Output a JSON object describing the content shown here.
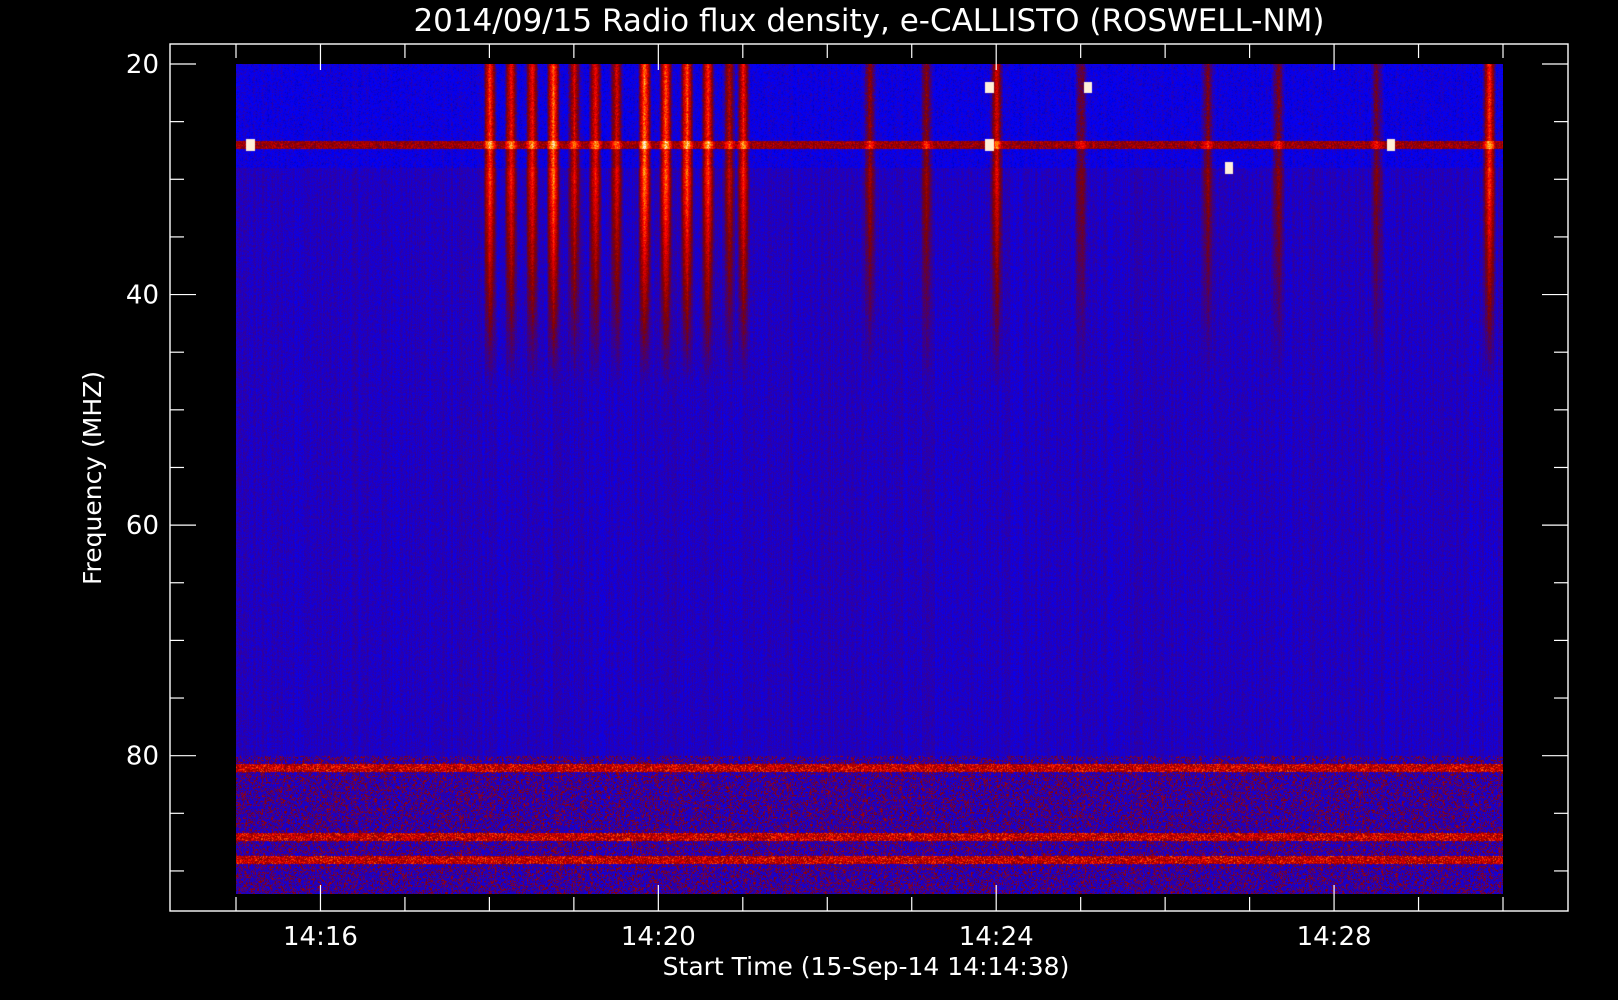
{
  "chart_data": {
    "type": "heatmap",
    "title": "2014/09/15  Radio flux density, e-CALLISTO (ROSWELL-NM)",
    "xlabel": "Start Time (15-Sep-14 14:14:38)",
    "ylabel": "Frequency (MHZ)",
    "x_axis": {
      "unit": "clock time",
      "range": [
        "14:14:38",
        "14:29:58"
      ],
      "major_ticks": [
        "14:16",
        "14:20",
        "14:24",
        "14:28"
      ],
      "minor_tick_interval_minutes": 1
    },
    "y_axis": {
      "unit": "MHz",
      "range": [
        20,
        92
      ],
      "inverted": true,
      "major_ticks": [
        20,
        40,
        60,
        80
      ],
      "minor_tick_interval": 5
    },
    "data_time_range": [
      "14:15:00",
      "14:30:00"
    ],
    "data_freq_range": [
      20,
      92
    ],
    "colormap": [
      "#000000",
      "#0000ff",
      "#7f0000",
      "#ff0000",
      "#ffa000",
      "#ffffff"
    ],
    "background_color": "#000000",
    "foreground_color": "#ffffff",
    "features": {
      "bursts": [
        {
          "time": "14:18:00",
          "strength": 0.8
        },
        {
          "time": "14:18:15",
          "strength": 0.7
        },
        {
          "time": "14:18:30",
          "strength": 0.7
        },
        {
          "time": "14:18:45",
          "strength": 0.95
        },
        {
          "time": "14:19:00",
          "strength": 0.6
        },
        {
          "time": "14:19:15",
          "strength": 0.7
        },
        {
          "time": "14:19:30",
          "strength": 0.6
        },
        {
          "time": "14:19:50",
          "strength": 1.0
        },
        {
          "time": "14:20:05",
          "strength": 0.9
        },
        {
          "time": "14:20:20",
          "strength": 0.9
        },
        {
          "time": "14:20:35",
          "strength": 0.8
        },
        {
          "time": "14:20:50",
          "strength": 0.5
        },
        {
          "time": "14:21:00",
          "strength": 0.7
        },
        {
          "time": "14:22:30",
          "strength": 0.4
        },
        {
          "time": "14:23:10",
          "strength": 0.35
        },
        {
          "time": "14:24:00",
          "strength": 0.6
        },
        {
          "time": "14:25:00",
          "strength": 0.3
        },
        {
          "time": "14:26:30",
          "strength": 0.35
        },
        {
          "time": "14:27:20",
          "strength": 0.35
        },
        {
          "time": "14:28:30",
          "strength": 0.3
        },
        {
          "time": "14:29:50",
          "strength": 0.8
        }
      ],
      "bright_spots": [
        {
          "time": "14:15:10",
          "freq": 27
        },
        {
          "time": "14:23:55",
          "freq": 22
        },
        {
          "time": "14:23:55",
          "freq": 27
        },
        {
          "time": "14:25:05",
          "freq": 22
        },
        {
          "time": "14:26:45",
          "freq": 29
        },
        {
          "time": "14:28:40",
          "freq": 27
        }
      ],
      "interference_bands_mhz": [
        27,
        81,
        87,
        89
      ]
    }
  }
}
